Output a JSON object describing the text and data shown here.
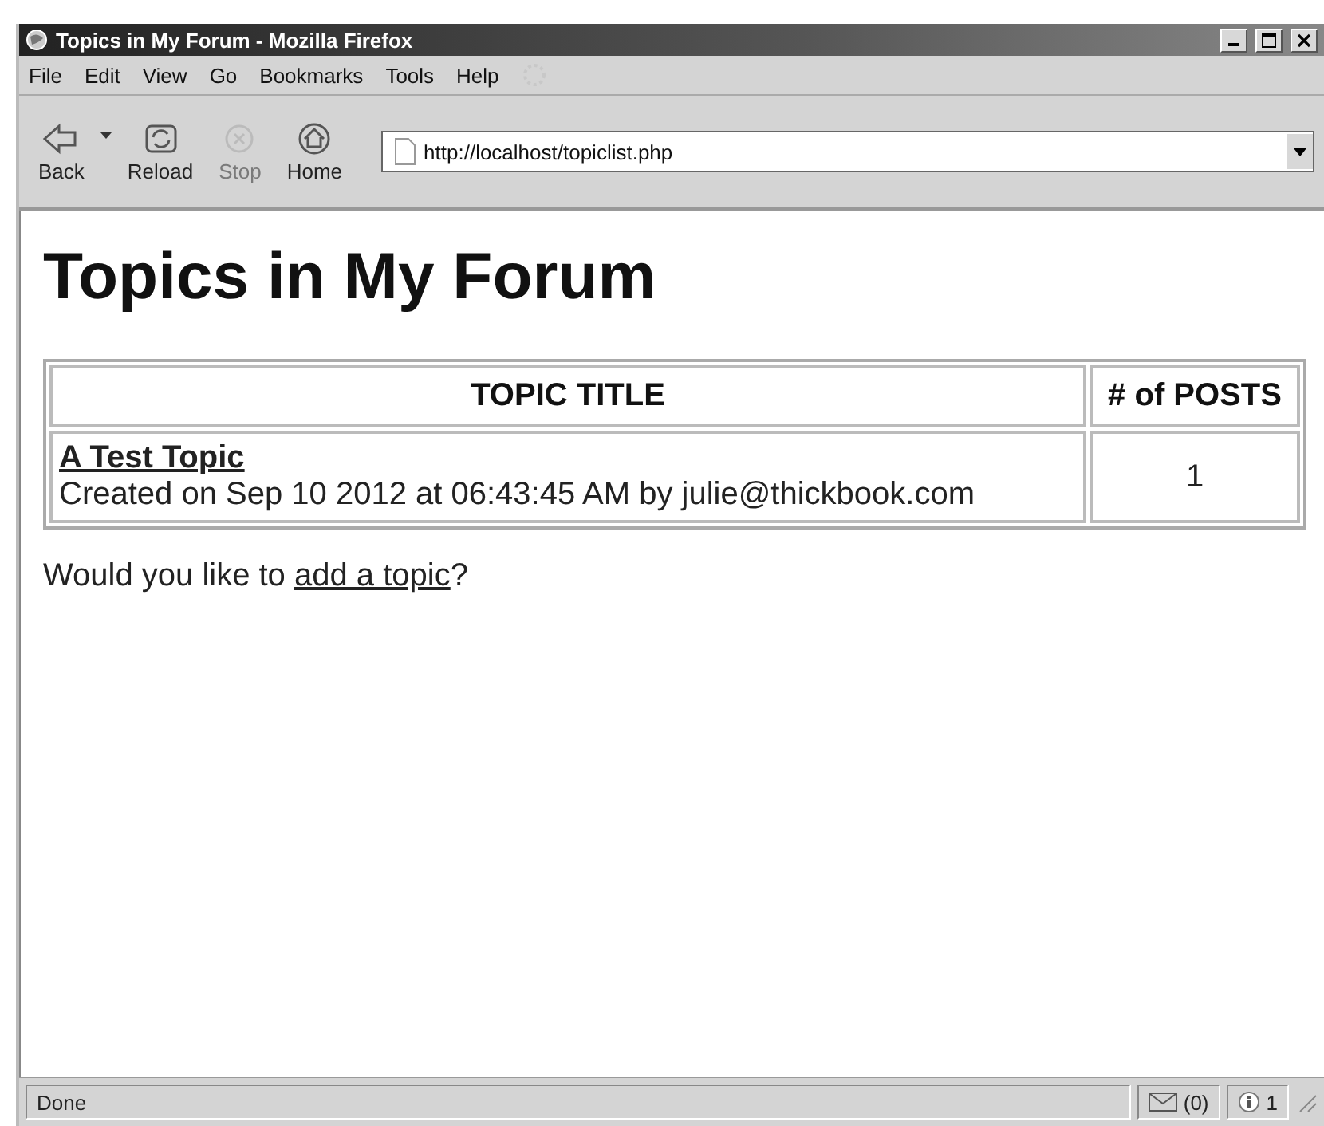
{
  "window": {
    "title": "Topics in My Forum - Mozilla Firefox"
  },
  "menu": [
    "File",
    "Edit",
    "View",
    "Go",
    "Bookmarks",
    "Tools",
    "Help"
  ],
  "toolbar": [
    {
      "kind": "back",
      "label": "Back",
      "disabled": false
    },
    {
      "kind": "reload",
      "label": "Reload",
      "disabled": false
    },
    {
      "kind": "stop",
      "label": "Stop",
      "disabled": true
    },
    {
      "kind": "home",
      "label": "Home",
      "disabled": false
    }
  ],
  "address": {
    "value": "http://localhost/topiclist.php"
  },
  "page": {
    "heading": "Topics in My Forum",
    "table": {
      "columns": [
        "TOPIC TITLE",
        "# of POSTS"
      ],
      "rows": [
        {
          "title": "A Test Topic",
          "created": "Created on Sep 10 2012 at 06:43:45 AM by julie@thickbook.com",
          "posts": "1"
        }
      ]
    },
    "prompt": {
      "before": "Would you like to ",
      "link": "add a topic",
      "after": "?"
    }
  },
  "status_bar": {
    "text": "Done",
    "mail": "(0)",
    "info": "1"
  }
}
